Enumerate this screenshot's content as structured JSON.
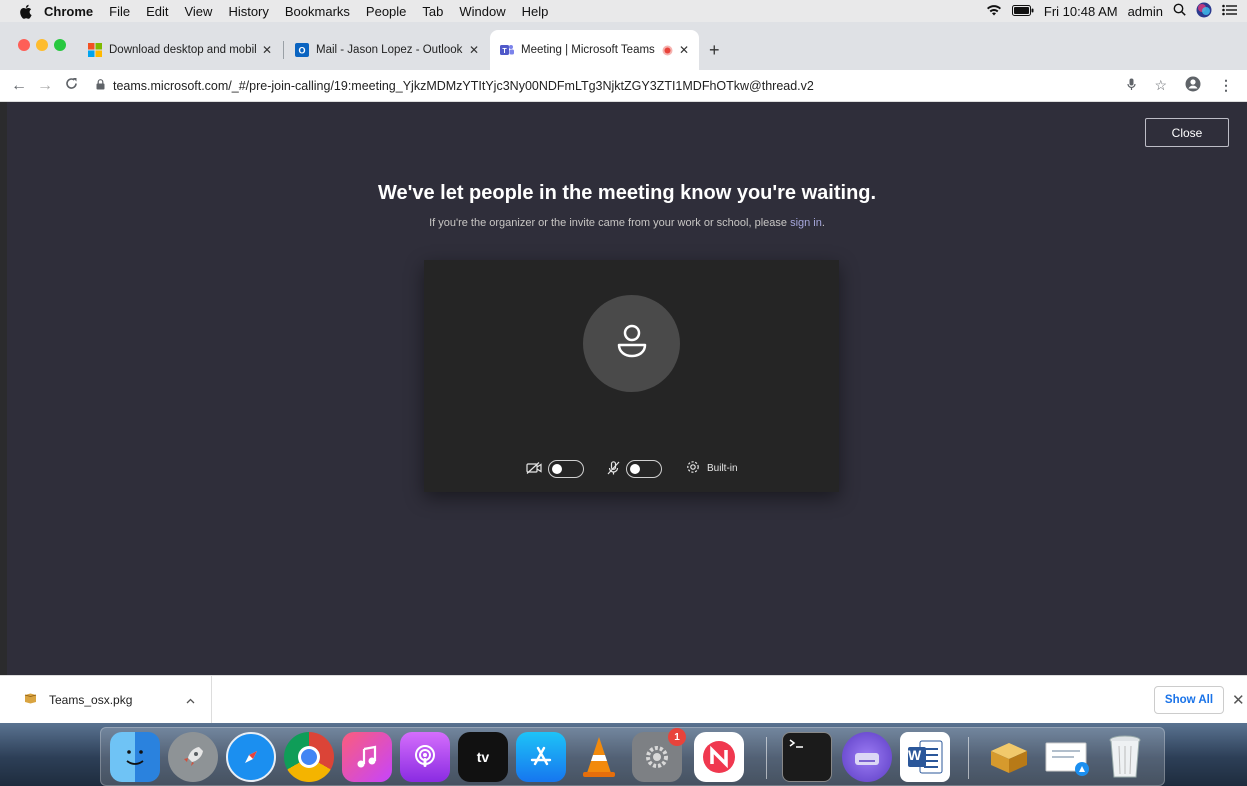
{
  "menubar": {
    "app": "Chrome",
    "items": [
      "File",
      "Edit",
      "View",
      "History",
      "Bookmarks",
      "People",
      "Tab",
      "Window",
      "Help"
    ],
    "clock": "Fri 10:48 AM",
    "user": "admin"
  },
  "tabs": [
    {
      "title": "Download desktop and mobile",
      "favicon": "microsoft-icon"
    },
    {
      "title": "Mail - Jason Lopez - Outlook",
      "favicon": "outlook-icon"
    },
    {
      "title": "Meeting | Microsoft Teams",
      "favicon": "teams-icon",
      "active": true
    }
  ],
  "address": {
    "url": "teams.microsoft.com/_#/pre-join-calling/19:meeting_YjkzMDMzYTItYjc3Ny00NDFmLTg3NjktZGY3ZTI1MDFhOTkw@thread.v2"
  },
  "page": {
    "close_label": "Close",
    "headline": "We've let people in the meeting know you're waiting.",
    "sub_prefix": "If you're the organizer or the invite came from your work or school, please ",
    "sub_link": "sign in",
    "sub_suffix": ".",
    "device_label": "Built-in"
  },
  "downloads": {
    "file": "Teams_osx.pkg",
    "show_all": "Show All"
  },
  "dock": {
    "tv_label": "tv",
    "settings_badge": "1",
    "word_label": "W"
  },
  "colors": {
    "page_bg": "#2f2e3a",
    "preview_bg": "#252525",
    "link": "#a6a7dc",
    "show_all": "#1a73e8"
  }
}
